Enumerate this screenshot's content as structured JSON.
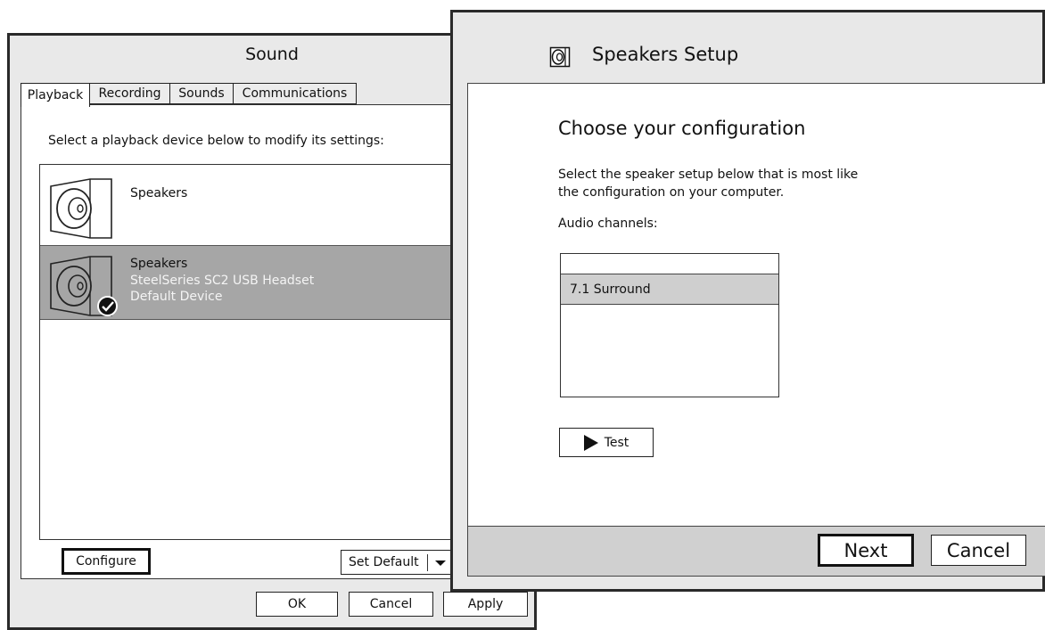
{
  "sound_dialog": {
    "title": "Sound",
    "tabs": [
      {
        "label": "Playback"
      },
      {
        "label": "Recording"
      },
      {
        "label": "Sounds"
      },
      {
        "label": "Communications"
      }
    ],
    "instruction": "Select a playback device below to modify its settings:",
    "devices": [
      {
        "name": "Speakers",
        "description": "",
        "status": ""
      },
      {
        "name": "Speakers",
        "description": "SteelSeries SC2 USB Headset",
        "status": "Default Device"
      }
    ],
    "configure_label": "Configure",
    "set_default_label": "Set Default",
    "ok_label": "OK",
    "cancel_label": "Cancel",
    "apply_label": "Apply"
  },
  "setup_dialog": {
    "title": "Speakers Setup",
    "heading": "Choose your configuration",
    "description_line1": "Select the speaker setup below that is most like",
    "description_line2": "the configuration on your computer.",
    "channels_label": "Audio channels:",
    "channel_options": [
      {
        "label": ""
      },
      {
        "label": "7.1 Surround"
      }
    ],
    "test_label": "Test",
    "next_label": "Next",
    "cancel_label": "Cancel"
  },
  "icons": {
    "speaker": "speaker-icon",
    "check": "checkmark-icon",
    "dropdown": "chevron-down-icon",
    "play": "play-icon"
  },
  "colors": {
    "selected_row": "#a6a6a6",
    "selected_channel": "#cfcfcf",
    "window_bg": "#e9e9e9"
  }
}
